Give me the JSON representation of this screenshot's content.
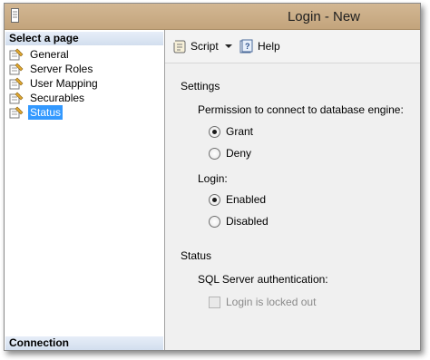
{
  "window": {
    "title": "Login - New"
  },
  "sidebar": {
    "header": "Select a page",
    "items": [
      {
        "label": "General",
        "selected": false
      },
      {
        "label": "Server Roles",
        "selected": false
      },
      {
        "label": "User Mapping",
        "selected": false
      },
      {
        "label": "Securables",
        "selected": false
      },
      {
        "label": "Status",
        "selected": true
      }
    ],
    "connection_header": "Connection"
  },
  "toolbar": {
    "script_label": "Script",
    "help_label": "Help"
  },
  "settings": {
    "title": "Settings",
    "permission_label": "Permission to connect to database engine:",
    "permission_options": [
      {
        "label": "Grant",
        "checked": true
      },
      {
        "label": "Deny",
        "checked": false
      }
    ],
    "login_label": "Login:",
    "login_options": [
      {
        "label": "Enabled",
        "checked": true
      },
      {
        "label": "Disabled",
        "checked": false
      }
    ]
  },
  "status": {
    "title": "Status",
    "auth_label": "SQL Server authentication:",
    "locked_out_label": "Login is locked out",
    "locked_out_checked": false,
    "locked_out_enabled": false
  }
}
